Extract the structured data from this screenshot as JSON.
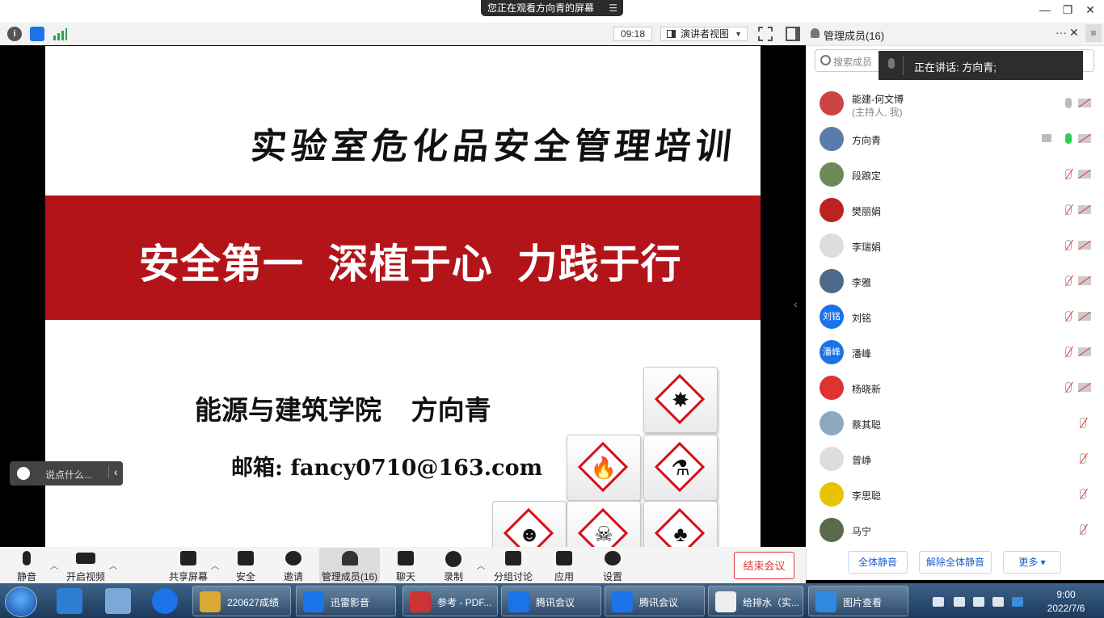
{
  "window": {
    "banner": "您正在观看方向青的屏幕",
    "min_icon": "minimize-icon",
    "max_icon": "restore-icon",
    "close_icon": "close-icon"
  },
  "toolbar": {
    "timer": "09:18",
    "view_label": "演讲者视图",
    "icons": [
      "info-icon",
      "shield-icon",
      "signal-icon",
      "fullscreen-icon",
      "sidebar-icon"
    ]
  },
  "slide": {
    "title": "实验室危化品安全管理培训",
    "slogan": "安全第一  深植于心  力践于行",
    "author": "能源与建筑学院    方向青",
    "email": "邮箱: fancy0710@163.com",
    "band_color": "#b3141a"
  },
  "chat": {
    "placeholder": "说点什么..."
  },
  "panel": {
    "title": "管理成员(16)",
    "search_placeholder": "搜索成员",
    "speaking": "正在讲话: 方向青;",
    "members": [
      {
        "name": "能建-何文博",
        "sub": "(主持人, 我)",
        "mic": "off",
        "cam": "muted",
        "color": "#c44"
      },
      {
        "name": "方向青",
        "mic": "on",
        "cam": "muted",
        "sharing": true,
        "color": "#5a7ca8"
      },
      {
        "name": "段踉定",
        "mic": "muted",
        "cam": "muted",
        "color": "#6a8a5a"
      },
      {
        "name": "樊丽娟",
        "mic": "muted",
        "cam": "muted",
        "color": "#b22"
      },
      {
        "name": "李瑞娟",
        "mic": "muted",
        "cam": "muted",
        "color": "#ddd"
      },
      {
        "name": "李雅",
        "mic": "muted",
        "cam": "muted",
        "color": "#4d6a8a"
      },
      {
        "name": "刘铭",
        "avatar_text": "刘铭",
        "mic": "muted",
        "cam": "muted",
        "color": "#1a73e8"
      },
      {
        "name": "潘峰",
        "avatar_text": "潘峰",
        "mic": "muted",
        "cam": "muted",
        "color": "#1a73e8"
      },
      {
        "name": "杨晓新",
        "mic": "muted",
        "cam": "muted",
        "color": "#d33"
      },
      {
        "name": "蔡其聪",
        "mic": "muted",
        "color": "#8fa8c0"
      },
      {
        "name": "曾峥",
        "mic": "muted",
        "color": "#ddd"
      },
      {
        "name": "李思聪",
        "mic": "muted",
        "color": "#e8c400"
      },
      {
        "name": "马宁",
        "mic": "muted",
        "color": "#5a6a4a"
      }
    ],
    "mute_all": "全体静音",
    "unmute_all": "解除全体静音",
    "more": "更多 ▾"
  },
  "controls": {
    "mute": "静音",
    "video": "开启视频",
    "share": "共享屏幕",
    "security": "安全",
    "invite": "邀请",
    "members": "管理成员(16)",
    "chat": "聊天",
    "record": "录制",
    "breakout": "分组讨论",
    "apps": "应用",
    "settings": "设置",
    "end": "结束会议"
  },
  "taskbar": {
    "tasks": [
      "220627成绩",
      "迅雷影音",
      "参考 - PDF...",
      "腾讯会议",
      "腾讯会议",
      "给排水（实...",
      "图片查看"
    ],
    "time": "9:00",
    "date": "2022/7/6"
  }
}
